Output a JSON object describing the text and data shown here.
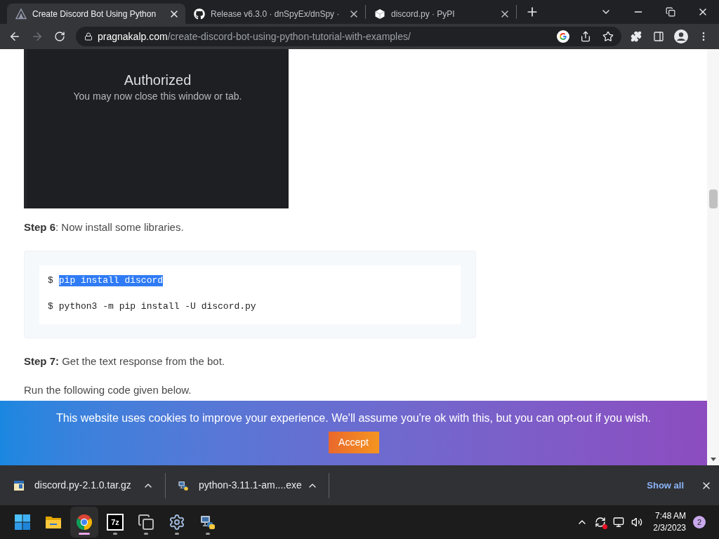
{
  "tabs": [
    {
      "kind": "site",
      "title": "Create Discord Bot Using Python",
      "selected": true
    },
    {
      "kind": "github",
      "title": "Release v6.3.0 · dnSpyEx/dnSpy ·",
      "selected": false
    },
    {
      "kind": "package",
      "title": "discord.py · PyPI",
      "selected": false
    }
  ],
  "toolbar": {
    "back_disabled": false,
    "forward_disabled": true,
    "address": {
      "domain": "pragnakalp.com",
      "path": "/create-discord-bot-using-python-tutorial-with-examples/"
    }
  },
  "page": {
    "image": {
      "heading": "Authorized",
      "text": "You may now close this window or tab."
    },
    "blocks": [
      {
        "kind": "paragraph",
        "text": "**Step 6**: Now install some libraries."
      },
      {
        "kind": "code",
        "lines": [
          {
            "prompt": "$",
            "command": "pip install discord",
            "selected": true
          },
          {
            "prompt": "$",
            "command": "python3 -m pip install -U discord.py",
            "selected": false
          }
        ]
      },
      {
        "kind": "paragraph",
        "text": "**Step 7:** Get the text response from the bot."
      },
      {
        "kind": "paragraph",
        "text": "Run the following code given below."
      }
    ]
  },
  "cookie_banner": {
    "message": "This website uses cookies to improve your experience. We'll assume you're ok with this, but you can opt-out if you wish.",
    "button": "Accept"
  },
  "downloads": {
    "items": [
      {
        "kind": "archive",
        "name": "discord.py-2.1.0.tar.gz"
      },
      {
        "kind": "installer",
        "name": "python-3.11.1-am....exe"
      }
    ],
    "show_all": "Show all"
  },
  "taskbar": {
    "apps": [
      {
        "kind": "start",
        "running": false,
        "active": false
      },
      {
        "kind": "folder",
        "running": false,
        "active": false
      },
      {
        "kind": "browser",
        "running": true,
        "active": true
      },
      {
        "kind": "archiver",
        "text": "7z",
        "running": true,
        "active": false
      },
      {
        "kind": "stacked",
        "running": true,
        "active": false
      },
      {
        "kind": "settings",
        "running": true,
        "active": false
      },
      {
        "kind": "installer",
        "running": true,
        "active": false
      }
    ],
    "clock": {
      "time": "7:48 AM",
      "date": "2/3/2023"
    },
    "notifications": "2"
  }
}
